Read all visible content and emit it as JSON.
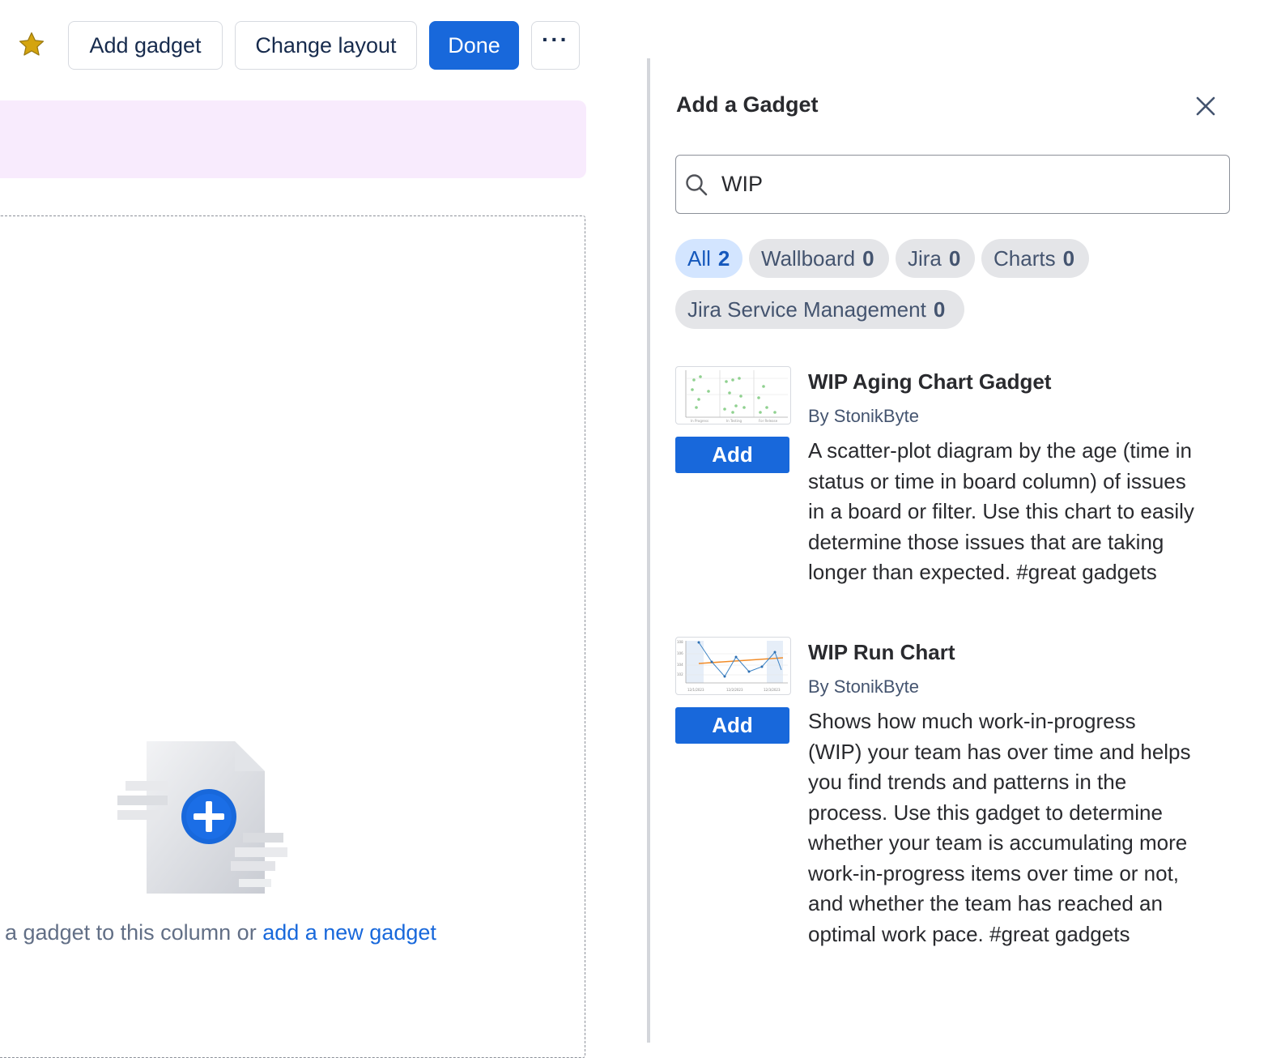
{
  "toolbar": {
    "add_gadget": "Add gadget",
    "change_layout": "Change layout",
    "done": "Done",
    "more": "···"
  },
  "dashboard": {
    "empty_text_prefix": "a gadget to this column or ",
    "empty_link": "add a new gadget"
  },
  "panel": {
    "title": "Add a Gadget",
    "search": {
      "value": "WIP",
      "placeholder": ""
    },
    "filters": [
      {
        "label": "All",
        "count": "2",
        "active": true
      },
      {
        "label": "Wallboard",
        "count": "0",
        "active": false
      },
      {
        "label": "Jira",
        "count": "0",
        "active": false
      },
      {
        "label": "Charts",
        "count": "0",
        "active": false
      },
      {
        "label": "Jira Service Management",
        "count": "0",
        "active": false
      }
    ],
    "results": [
      {
        "name": "WIP Aging Chart Gadget",
        "author": "By StonikByte",
        "add_label": "Add",
        "thumbnail": "scatter-chart-thumbnail",
        "desc_lines": [
          "A scatter-plot diagram by the age (time in",
          "status or time in board column) of issues",
          "in a board or filter. Use this chart to easily",
          "determine those issues that are taking",
          "longer than expected. #great gadgets"
        ]
      },
      {
        "name": "WIP Run Chart",
        "author": "By StonikByte",
        "add_label": "Add",
        "thumbnail": "run-chart-thumbnail",
        "desc_lines": [
          "Shows how much work-in-progress",
          "(WIP) your team has over time and helps",
          "you find trends and patterns in the",
          "process. Use this gadget to determine",
          "whether your team is accumulating more",
          "work-in-progress items over time or not,",
          "and whether the team has reached an",
          "optimal work pace. #great gadgets"
        ]
      }
    ]
  },
  "colors": {
    "primary": "#1868db",
    "banner": "#f8ebfd",
    "chip_active_bg": "#d3e5ff",
    "chip_bg": "#e4e5e8",
    "star": "#d4a40e"
  },
  "icons": [
    "star-icon",
    "more-icon",
    "close-icon",
    "search-icon",
    "add-gadget-illustration"
  ]
}
